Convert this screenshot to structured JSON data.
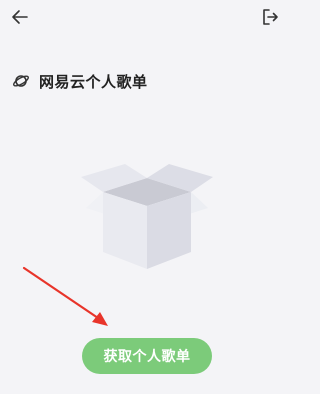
{
  "header": {
    "back_icon": "arrow-left-icon",
    "exit_icon": "logout-icon"
  },
  "main": {
    "title_icon": "planet-icon",
    "title": "网易云个人歌单",
    "illustration": "open-empty-box",
    "primary_button_label": "获取个人歌单"
  },
  "annotation": {
    "arrow_color": "#e8342a"
  },
  "colors": {
    "background": "#f4f4f7",
    "accent": "#7ccb7a",
    "text": "#222222"
  }
}
